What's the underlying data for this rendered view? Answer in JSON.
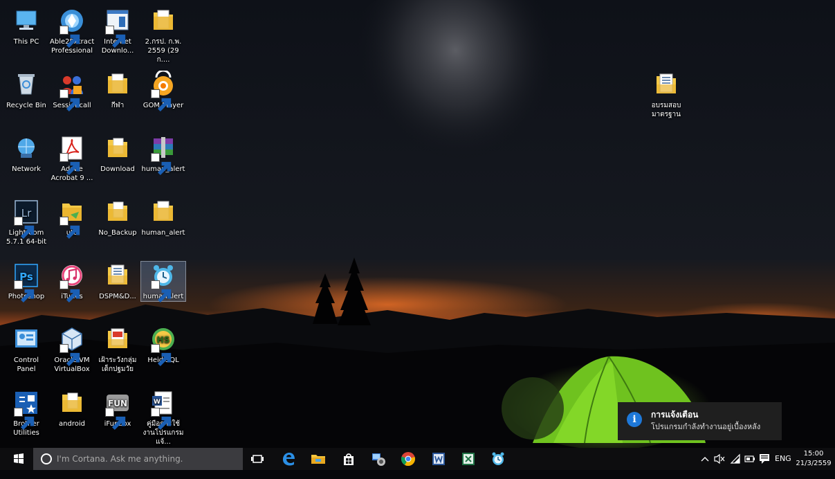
{
  "desktop": {
    "icons": [
      {
        "label": "This PC"
      },
      {
        "label": "Able2Extract Professional"
      },
      {
        "label": "Internet Downlo..."
      },
      {
        "label": "2.กรป. ก.พ. 2559 (29 ก...."
      },
      {
        "label": "Recycle Bin"
      },
      {
        "label": "Sessioncall"
      },
      {
        "label": "กีฬา"
      },
      {
        "label": "GOM Player"
      },
      {
        "label": "Network"
      },
      {
        "label": "Adobe Acrobat 9 ..."
      },
      {
        "label": "Download"
      },
      {
        "label": "human_alert"
      },
      {
        "label": "Lightroom 5.7.1 64-bit"
      },
      {
        "label": "uto"
      },
      {
        "label": "No_Backup"
      },
      {
        "label": "human_alert"
      },
      {
        "label": "Photoshop"
      },
      {
        "label": "iTunes"
      },
      {
        "label": "DSPM&D..."
      },
      {
        "label": "humanAlert"
      },
      {
        "label": "Control Panel"
      },
      {
        "label": "Oracle VM VirtualBox"
      },
      {
        "label": "เฝ้าระวังกลุ่มเด็กปฐมวัย"
      },
      {
        "label": "HeidiSQL"
      },
      {
        "label": "Brother Utilities"
      },
      {
        "label": "android"
      },
      {
        "label": "iFunbox"
      },
      {
        "label": "คู่มือการใช้งานโปรแกรมแจ้..."
      },
      {
        "label": "อบรมสอบมาตรฐาน"
      }
    ]
  },
  "notification": {
    "title": "การแจ้งเตือน",
    "message": "โปรแกรมกำลังทำงานอยู่เบื้องหลัง",
    "icon": "info-icon"
  },
  "taskbar": {
    "search_placeholder": "I'm Cortana. Ask me anything.",
    "apps": [
      "task-view",
      "edge",
      "file-explorer",
      "store",
      "network-app",
      "chrome",
      "word",
      "excel",
      "alarm-clock"
    ],
    "language": "ENG",
    "time": "15:00",
    "date": "21/3/2559"
  },
  "colors": {
    "taskbar": "#0d0d0f",
    "search_box": "#3b3b3f",
    "notification_bg": "#1f1f1f",
    "info_blue": "#1e78d8",
    "tent_green": "#6fc21f",
    "sunset_orange": "#d9682a"
  }
}
